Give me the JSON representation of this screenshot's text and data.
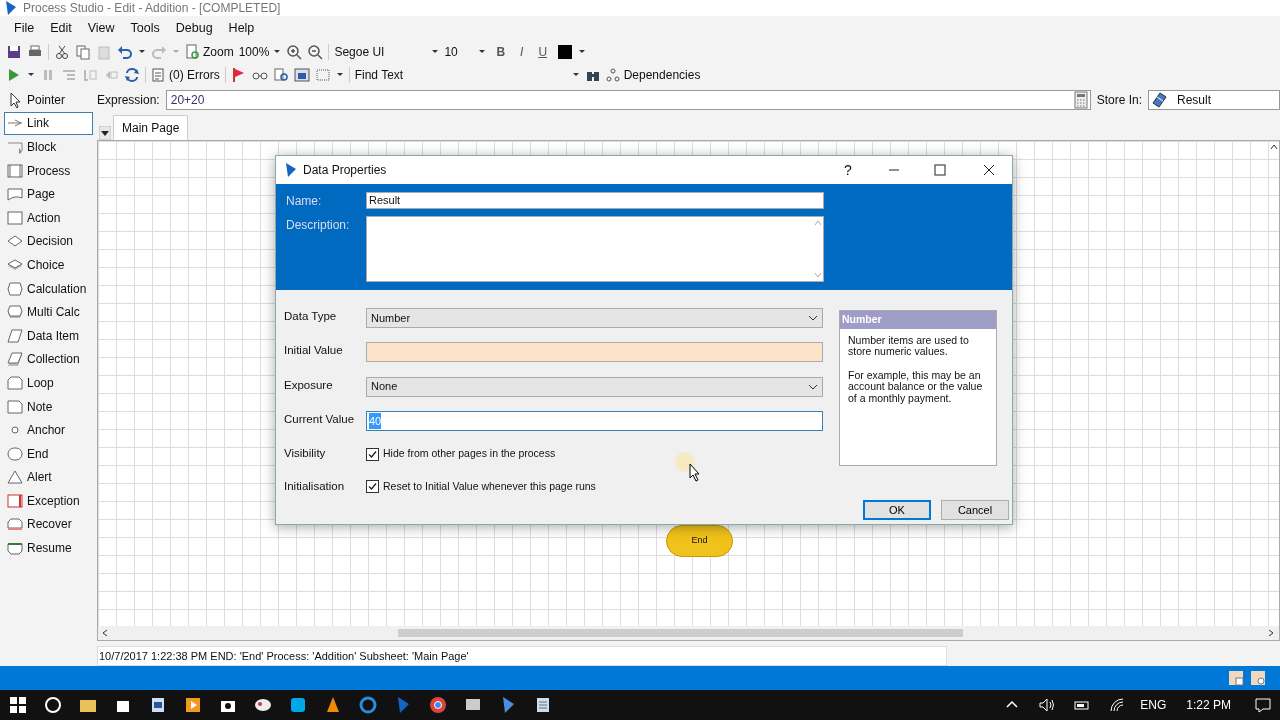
{
  "window": {
    "title": "Process Studio  - Edit - Addition - [COMPLETED]"
  },
  "menu": [
    "File",
    "Edit",
    "View",
    "Tools",
    "Debug",
    "Help"
  ],
  "toolbar": {
    "zoom_label": "Zoom",
    "zoom_value": "100%",
    "font": "Segoe UI",
    "font_size": "10",
    "bold": "B",
    "italic": "I",
    "underline": "U",
    "errors": "(0) Errors",
    "find_text": "Find Text",
    "dependencies": "Dependencies"
  },
  "toolbox": [
    {
      "label": "Pointer",
      "kind": "pointer",
      "selected": false
    },
    {
      "label": "Link",
      "kind": "link",
      "selected": true
    },
    {
      "label": "Block",
      "kind": "block",
      "selected": false
    },
    {
      "label": "Process",
      "kind": "process",
      "selected": false
    },
    {
      "label": "Page",
      "kind": "page",
      "selected": false
    },
    {
      "label": "Action",
      "kind": "action",
      "selected": false
    },
    {
      "label": "Decision",
      "kind": "decision",
      "selected": false
    },
    {
      "label": "Choice",
      "kind": "choice",
      "selected": false
    },
    {
      "label": "Calculation",
      "kind": "calculation",
      "selected": false
    },
    {
      "label": "Multi Calc",
      "kind": "multicalc",
      "selected": false
    },
    {
      "label": "Data Item",
      "kind": "dataitem",
      "selected": false
    },
    {
      "label": "Collection",
      "kind": "collection",
      "selected": false
    },
    {
      "label": "Loop",
      "kind": "loop",
      "selected": false
    },
    {
      "label": "Note",
      "kind": "note",
      "selected": false
    },
    {
      "label": "Anchor",
      "kind": "anchor",
      "selected": false
    },
    {
      "label": "End",
      "kind": "end",
      "selected": false
    },
    {
      "label": "Alert",
      "kind": "alert",
      "selected": false
    },
    {
      "label": "Exception",
      "kind": "exception",
      "selected": false
    },
    {
      "label": "Recover",
      "kind": "recover",
      "selected": false
    },
    {
      "label": "Resume",
      "kind": "resume",
      "selected": false
    }
  ],
  "expression": {
    "label": "Expression:",
    "value": "20+20"
  },
  "store_in": {
    "label": "Store In:",
    "value": "Result"
  },
  "tabs": [
    {
      "label": "Main Page",
      "selected": true
    }
  ],
  "canvas": {
    "node": {
      "label": "End"
    }
  },
  "status_bar": "10/7/2017 1:22:38 PM END: 'End' Process: 'Addition' Subsheet: 'Main Page'",
  "dialog": {
    "title": "Data Properties",
    "help": "?",
    "name": {
      "label": "Name:",
      "value": "Result"
    },
    "description": {
      "label": "Description:"
    },
    "fields": [
      {
        "kind": "select",
        "label": "Data Type",
        "value": "Number"
      },
      {
        "kind": "input",
        "label": "Initial Value"
      },
      {
        "kind": "select",
        "label": "Exposure",
        "value": "None"
      },
      {
        "kind": "input",
        "label": "Current Value",
        "value": "40",
        "selected": true
      }
    ],
    "checks": [
      {
        "label": "Visibility",
        "text": "Hide from other pages in the process",
        "checked": true
      },
      {
        "label": "Initialisation",
        "text": "Reset to Initial Value whenever this page runs",
        "checked": true
      }
    ],
    "info": {
      "title": "Number",
      "paragraphs": [
        "Number items are used to store numeric values.",
        "For example, this may be an account balance or the value of a monthly payment."
      ]
    },
    "buttons": [
      "OK",
      "Cancel"
    ]
  },
  "taskbar": {
    "language": "ENG",
    "clock": "1:22 PM"
  }
}
